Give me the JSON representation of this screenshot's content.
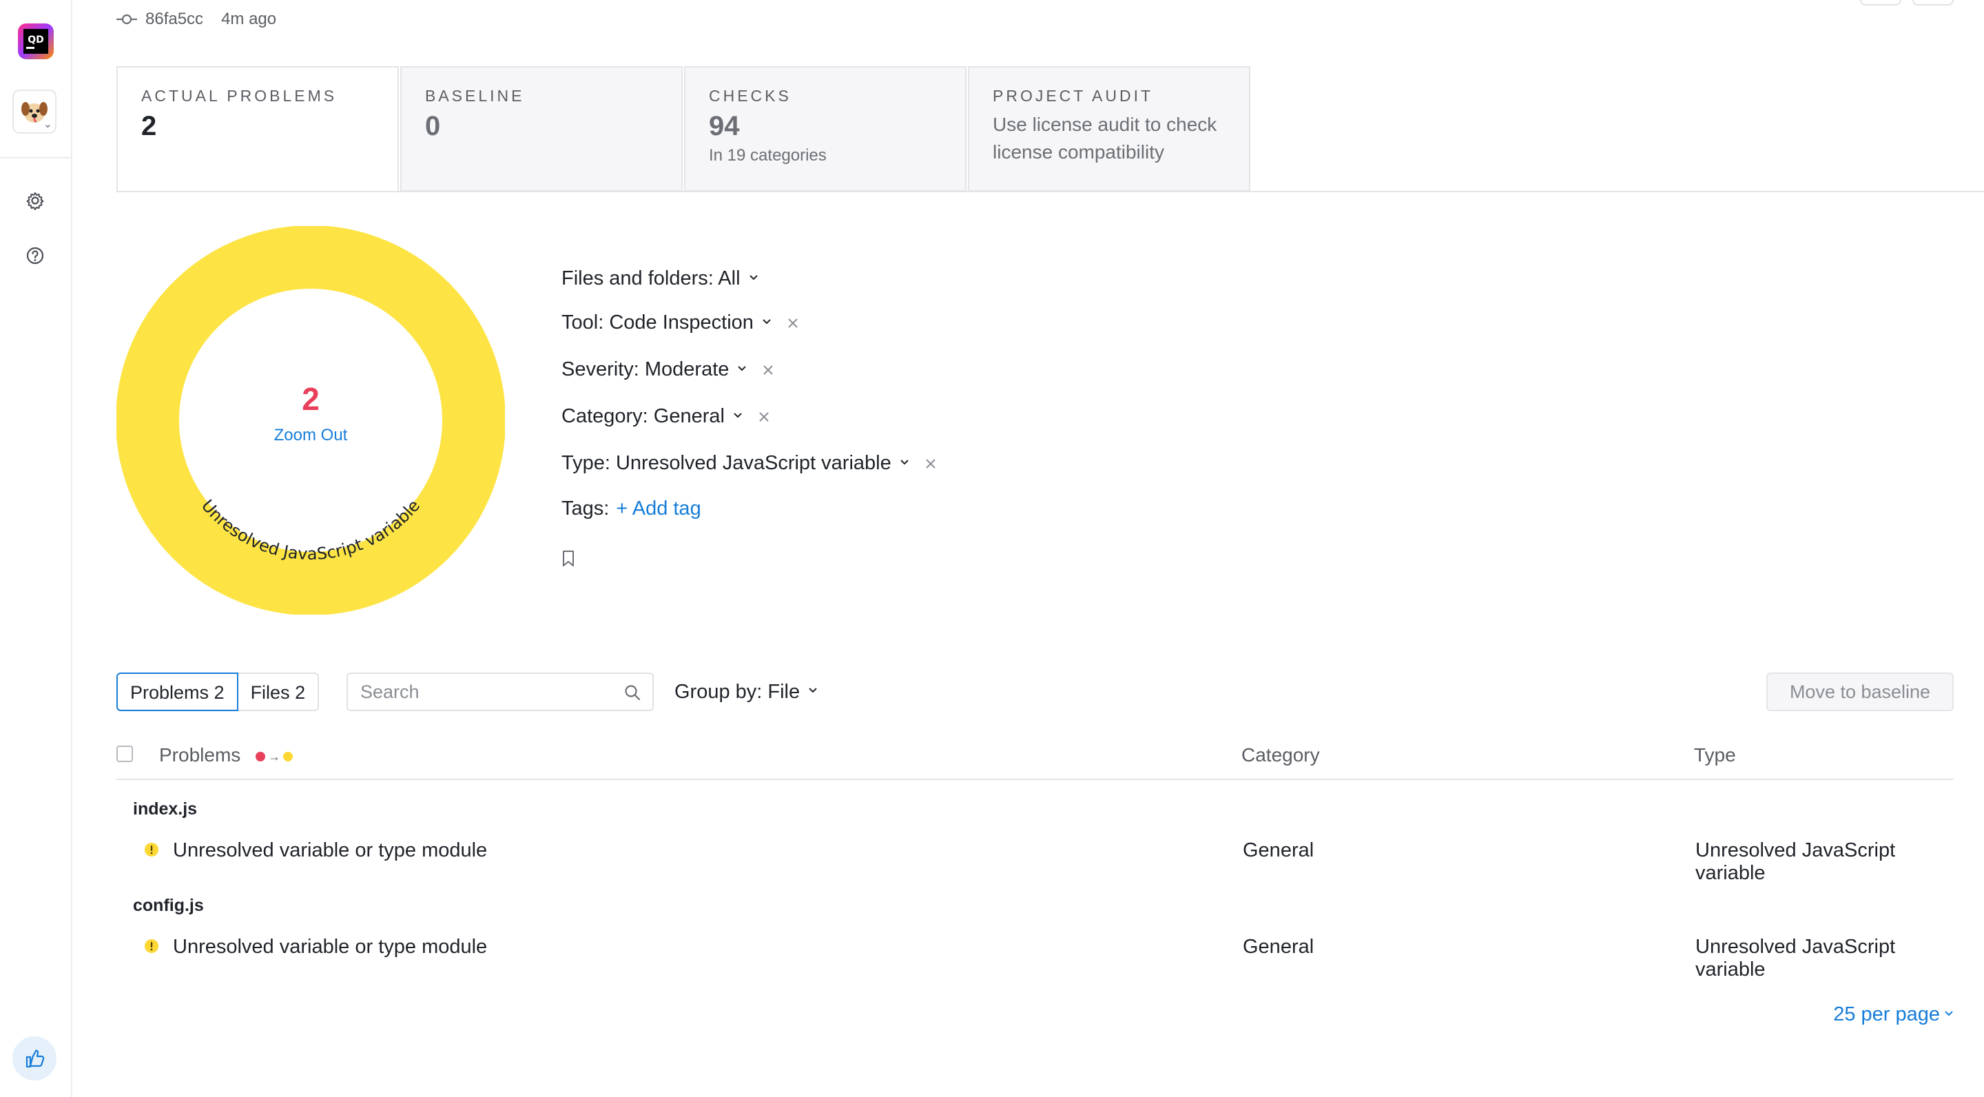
{
  "commit": {
    "hash": "86fa5cc",
    "time": "4m ago"
  },
  "cards": [
    {
      "title": "ACTUAL PROBLEMS",
      "value": "2"
    },
    {
      "title": "BASELINE",
      "value": "0"
    },
    {
      "title": "CHECKS",
      "value": "94",
      "sub": "In 19 categories"
    },
    {
      "title": "PROJECT AUDIT",
      "line1": "Use license audit to check",
      "line2": "license compatibility"
    }
  ],
  "donut": {
    "count": "2",
    "zoom_label": "Zoom Out",
    "segment_label": "Unresolved JavaScript variable",
    "segment_color": "#fde444"
  },
  "filters": {
    "files": "Files and folders: All",
    "tool": "Tool: Code Inspection",
    "severity": "Severity: Moderate",
    "category": "Category: General",
    "type": "Type: Unresolved JavaScript variable",
    "tags_label": "Tags:",
    "add_tag": "+ Add tag"
  },
  "toolbar": {
    "problems_tab": "Problems 2",
    "files_tab": "Files 2",
    "search_placeholder": "Search",
    "group_by": "Group by: File",
    "move_to_baseline": "Move to baseline"
  },
  "table": {
    "headers": {
      "problems": "Problems",
      "category": "Category",
      "type": "Type"
    },
    "groups": [
      {
        "file": "index.js",
        "problems": [
          {
            "message": "Unresolved variable or type module",
            "category": "General",
            "type": "Unresolved JavaScript variable"
          }
        ]
      },
      {
        "file": "config.js",
        "problems": [
          {
            "message": "Unresolved variable or type module",
            "category": "General",
            "type": "Unresolved JavaScript variable"
          }
        ]
      }
    ]
  },
  "pagination": {
    "per_page": "25 per page"
  },
  "colors": {
    "accent": "#167dd9",
    "critical": "#e8405a",
    "moderate": "#fdd835"
  }
}
